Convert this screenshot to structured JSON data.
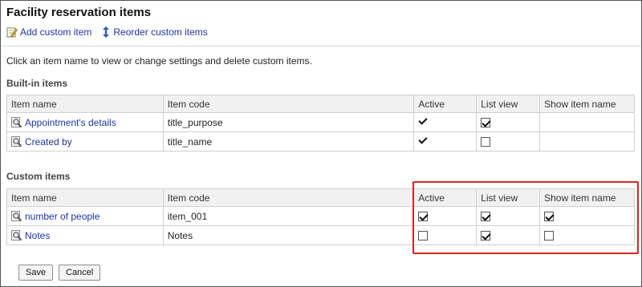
{
  "page": {
    "title": "Facility reservation items",
    "toolbar": {
      "add_label": "Add custom item",
      "reorder_label": "Reorder custom items"
    },
    "description": "Click an item name to view or change settings and delete custom items."
  },
  "builtin": {
    "heading": "Built-in items",
    "columns": [
      "Item name",
      "Item code",
      "Active",
      "List view",
      "Show item name"
    ],
    "rows": [
      {
        "name": "Appointment's details",
        "code": "title_purpose",
        "active": true,
        "list_view": true
      },
      {
        "name": "Created by",
        "code": "title_name",
        "active": true,
        "list_view": false
      }
    ]
  },
  "custom": {
    "heading": "Custom items",
    "columns": [
      "Item name",
      "Item code",
      "Active",
      "List view",
      "Show item name"
    ],
    "rows": [
      {
        "name": "number of people",
        "code": "item_001",
        "active": true,
        "list_view": true,
        "show_item_name": true
      },
      {
        "name": "Notes",
        "code": "Notes",
        "active": false,
        "list_view": true,
        "show_item_name": false
      }
    ]
  },
  "actions": {
    "save_label": "Save",
    "cancel_label": "Cancel"
  },
  "colors": {
    "link": "#1a36a8",
    "highlight": "#e02020",
    "header_bg": "#f1f1f1"
  }
}
